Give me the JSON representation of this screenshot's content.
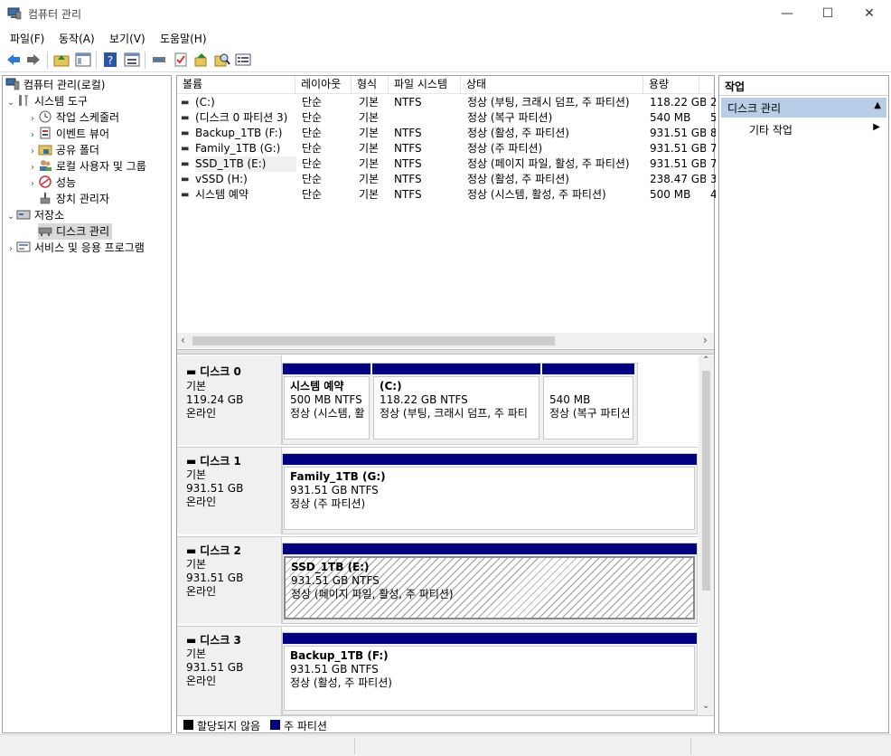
{
  "window": {
    "title": "컴퓨터 관리",
    "minimize": "—",
    "maximize": "☐",
    "close": "✕"
  },
  "menu": [
    "파일(F)",
    "동작(A)",
    "보기(V)",
    "도움말(H)"
  ],
  "tree": {
    "root": "컴퓨터 관리(로컬)",
    "system_tools": "시스템 도구",
    "task_scheduler": "작업 스케줄러",
    "event_viewer": "이벤트 뷰어",
    "shared_folders": "공유 폴더",
    "local_users": "로컬 사용자 및 그룹",
    "performance": "성능",
    "device_manager": "장치 관리자",
    "storage": "저장소",
    "disk_management": "디스크 관리",
    "services": "서비스 및 응용 프로그램"
  },
  "volume_table": {
    "headers": [
      "볼륨",
      "레이아웃",
      "형식",
      "파일 시스템",
      "상태",
      "용량"
    ],
    "rows": [
      {
        "volume": " (C:)",
        "layout": "단순",
        "type": "기본",
        "fs": "NTFS",
        "status": "정상 (부팅, 크래시 덤프, 주 파티션)",
        "capacity": "118.22 GB",
        "extra": "2"
      },
      {
        "volume": "(디스크 0 파티션 3)",
        "layout": "단순",
        "type": "기본",
        "fs": "",
        "status": "정상 (복구 파티션)",
        "capacity": "540 MB",
        "extra": "5"
      },
      {
        "volume": "Backup_1TB (F:)",
        "layout": "단순",
        "type": "기본",
        "fs": "NTFS",
        "status": "정상 (활성, 주 파티션)",
        "capacity": "931.51 GB",
        "extra": "8"
      },
      {
        "volume": "Family_1TB (G:)",
        "layout": "단순",
        "type": "기본",
        "fs": "NTFS",
        "status": "정상 (주 파티션)",
        "capacity": "931.51 GB",
        "extra": "7"
      },
      {
        "volume": "SSD_1TB (E:)",
        "layout": "단순",
        "type": "기본",
        "fs": "NTFS",
        "status": "정상 (페이지 파일, 활성, 주 파티션)",
        "capacity": "931.51 GB",
        "extra": "7"
      },
      {
        "volume": "vSSD (H:)",
        "layout": "단순",
        "type": "기본",
        "fs": "NTFS",
        "status": "정상 (활성, 주 파티션)",
        "capacity": "238.47 GB",
        "extra": "3"
      },
      {
        "volume": "시스템 예약",
        "layout": "단순",
        "type": "기본",
        "fs": "NTFS",
        "status": "정상 (시스템, 활성, 주 파티션)",
        "capacity": "500 MB",
        "extra": "4"
      }
    ]
  },
  "disks": [
    {
      "name": "디스크 0",
      "type": "기본",
      "size": "119.24 GB",
      "state": "온라인",
      "partitions": [
        {
          "title": "시스템 예약",
          "size": "500 MB NTFS",
          "status": "정상 (시스템, 활"
        },
        {
          "title": " (C:)",
          "size": "118.22 GB NTFS",
          "status": "정상 (부팅, 크래시 덤프, 주 파티"
        },
        {
          "title": "",
          "size": "540 MB",
          "status": "정상 (복구 파티션"
        }
      ]
    },
    {
      "name": "디스크 1",
      "type": "기본",
      "size": "931.51 GB",
      "state": "온라인",
      "partitions": [
        {
          "title": "Family_1TB  (G:)",
          "size": "931.51 GB NTFS",
          "status": "정상 (주 파티션)"
        }
      ]
    },
    {
      "name": "디스크 2",
      "type": "기본",
      "size": "931.51 GB",
      "state": "온라인",
      "partitions": [
        {
          "title": "SSD_1TB  (E:)",
          "size": "931.51 GB NTFS",
          "status": "정상 (페이지 파일, 활성, 주 파티션)"
        }
      ]
    },
    {
      "name": "디스크 3",
      "type": "기본",
      "size": "931.51 GB",
      "state": "온라인",
      "partitions": [
        {
          "title": "Backup_1TB  (F:)",
          "size": "931.51 GB NTFS",
          "status": "정상 (활성, 주 파티션)"
        }
      ]
    }
  ],
  "legend": {
    "unallocated": "할당되지 않음",
    "primary": "주 파티션"
  },
  "actions": {
    "header": "작업",
    "section": "디스크 관리",
    "more": "기타 작업"
  },
  "colors": {
    "partition_bar": "#000080",
    "selection": "#cce8ff",
    "actions_section": "#b8cde6"
  }
}
